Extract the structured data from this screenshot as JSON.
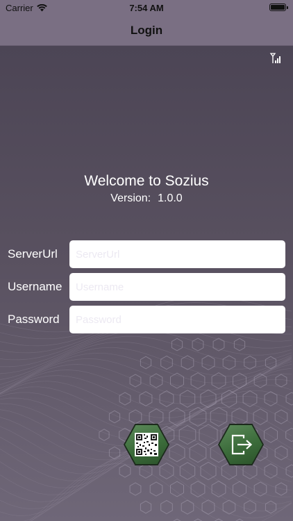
{
  "status_bar": {
    "carrier": "Carrier",
    "time": "7:54 AM",
    "icons": [
      "wifi-icon",
      "battery-icon"
    ]
  },
  "nav": {
    "title": "Login"
  },
  "main": {
    "welcome": "Welcome to Sozius",
    "version_label": "Version:",
    "version_value": "1.0.0",
    "signal_icon": "signal-antenna-icon"
  },
  "form": {
    "server_url": {
      "label": "ServerUrl",
      "placeholder": "ServerUrl",
      "value": ""
    },
    "username": {
      "label": "Username",
      "placeholder": "Username",
      "value": ""
    },
    "password": {
      "label": "Password",
      "placeholder": "Password",
      "value": ""
    }
  },
  "actions": {
    "qr_icon": "qr-code-icon",
    "logout_icon": "logout-icon"
  },
  "colors": {
    "nav_bg": "#7a6f83",
    "content_bg": "#595160",
    "button_green": "#3b6b3a"
  }
}
